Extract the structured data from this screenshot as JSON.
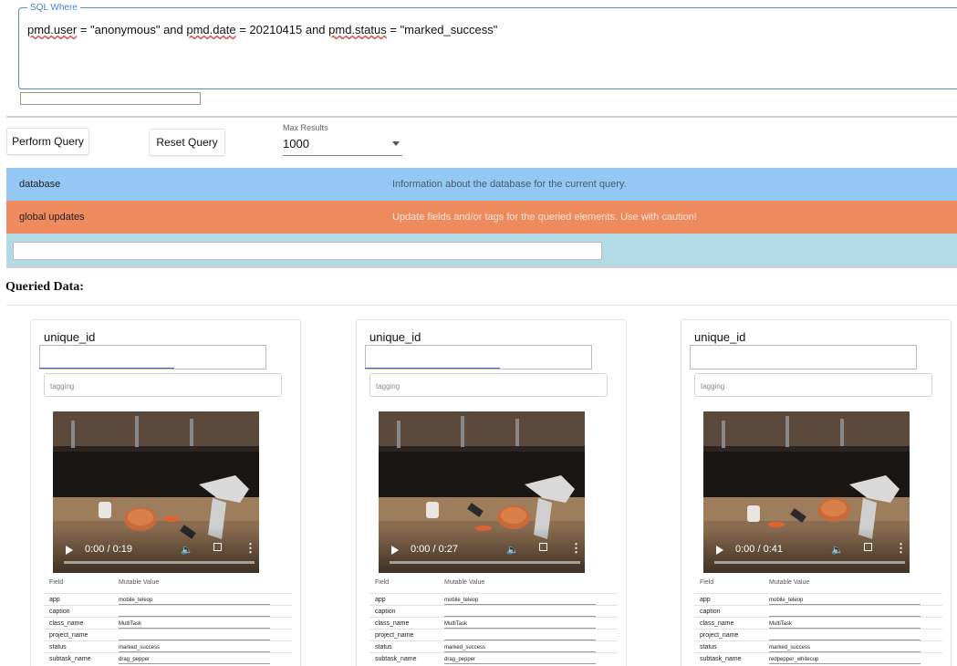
{
  "query": {
    "legend": "SQL Where",
    "sql_parts": [
      "pmd.user",
      " = \"anonymous\" and ",
      "pmd.date",
      " = 20210415 and ",
      "pmd.status",
      " = \"marked_success\""
    ]
  },
  "controls": {
    "perform_label": "Perform Query",
    "reset_label": "Reset Query",
    "max_results_label": "Max Results",
    "max_results_value": "1000"
  },
  "panels": {
    "database": {
      "name": "database",
      "description": "Information about the database for the current query.",
      "color": "#94c8f4"
    },
    "global_updates": {
      "name": "global updates",
      "description": "Update fields and/or tags for the queried elements. Use with caution!",
      "color": "#ee8a5e"
    }
  },
  "section_title": "Queried Data:",
  "cards": [
    {
      "uid_label": "unique_id",
      "tag_placeholder": "tagging",
      "video_time": "0:00 / 0:19",
      "progress": 0.0,
      "field_header": "Field",
      "value_header": "Mutable Value",
      "rows": [
        {
          "field": "app",
          "value": "mobile_teleop"
        },
        {
          "field": "caption",
          "value": ""
        },
        {
          "field": "class_name",
          "value": "MultiTask"
        },
        {
          "field": "project_name",
          "value": ""
        },
        {
          "field": "status",
          "value": "marked_success"
        },
        {
          "field": "subtask_name",
          "value": "drag_pepper"
        }
      ]
    },
    {
      "uid_label": "unique_id",
      "tag_placeholder": "tagging",
      "video_time": "0:00 / 0:27",
      "progress": 0.0,
      "field_header": "Field",
      "value_header": "Mutable Value",
      "rows": [
        {
          "field": "app",
          "value": "mobile_teleop"
        },
        {
          "field": "caption",
          "value": ""
        },
        {
          "field": "class_name",
          "value": "MultiTask"
        },
        {
          "field": "project_name",
          "value": ""
        },
        {
          "field": "status",
          "value": "marked_success"
        },
        {
          "field": "subtask_name",
          "value": "drag_pepper"
        }
      ]
    },
    {
      "uid_label": "unique_id",
      "tag_placeholder": "tagging",
      "video_time": "0:00 / 0:41",
      "progress": 0.0,
      "field_header": "Field",
      "value_header": "Mutable Value",
      "rows": [
        {
          "field": "app",
          "value": "mobile_teleop"
        },
        {
          "field": "caption",
          "value": ""
        },
        {
          "field": "class_name",
          "value": "MultiTask"
        },
        {
          "field": "project_name",
          "value": ""
        },
        {
          "field": "status",
          "value": "marked_success"
        },
        {
          "field": "subtask_name",
          "value": "redpepper_whitecup"
        }
      ]
    }
  ],
  "icons": {
    "play": "play-icon",
    "volume": "volume-icon",
    "fullscreen": "fullscreen-icon",
    "more": "more-vertical-icon",
    "dropdown": "chevron-down-icon"
  }
}
